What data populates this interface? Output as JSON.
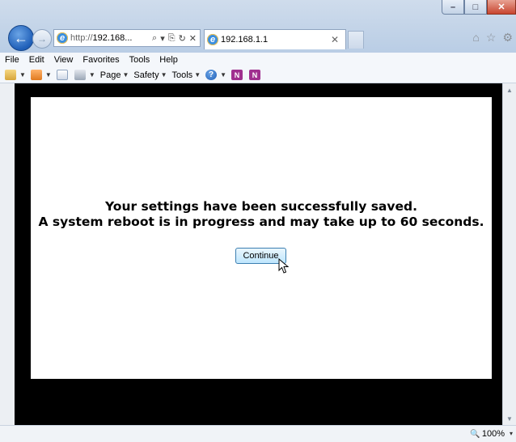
{
  "window": {
    "min_glyph": "–",
    "max_glyph": "□",
    "close_glyph": "✕"
  },
  "nav": {
    "back_glyph": "←",
    "forward_glyph": "→"
  },
  "address": {
    "prefix": "http://",
    "host": "192.168...",
    "search_glyph": "⌕",
    "dropdown_glyph": "▾",
    "compat_glyph": "⎘",
    "refresh_glyph": "↻",
    "stop_glyph": "✕"
  },
  "tab": {
    "title": "192.168.1.1",
    "close_glyph": "✕"
  },
  "toolbar_right": {
    "home_glyph": "⌂",
    "favorites_glyph": "☆",
    "tools_glyph": "⚙"
  },
  "menu": [
    "File",
    "Edit",
    "View",
    "Favorites",
    "Tools",
    "Help"
  ],
  "command_bar": {
    "page_label": "Page",
    "safety_label": "Safety",
    "tools_label": "Tools",
    "help_glyph": "?",
    "onenote_glyph": "N"
  },
  "page": {
    "line1": "Your settings have been successfully saved.",
    "line2": "A system reboot is in progress and may take up to 60 seconds.",
    "continue_label": "Continue"
  },
  "status": {
    "zoom_glyph": "🔍",
    "zoom": "100%",
    "zoom_dropdown": "▾"
  },
  "colors": {
    "accent": "#1f5fb8",
    "content_bg": "#000000",
    "page_bg": "#ffffff"
  }
}
